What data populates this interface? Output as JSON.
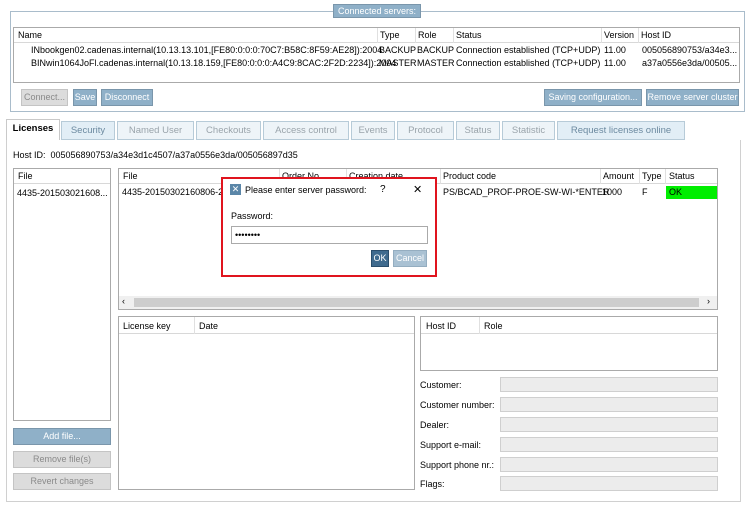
{
  "servers": {
    "title": "Connected servers:",
    "columns": [
      "Name",
      "Type",
      "Role",
      "Status",
      "Version",
      "Host ID"
    ],
    "rows": [
      [
        "INbookgen02.cadenas.internal(10.13.13.101,[FE80:0:0:0:70C7:B58C:8F59:AE28]):2004",
        "BACKUP",
        "BACKUP",
        "Connection established (TCP+UDP)",
        "11.00",
        "005056890753/a34e3..."
      ],
      [
        "BINwin1064JoFl.cadenas.internal(10.13.18.159,[FE80:0:0:0:A4C9:8CAC:2F2D:2234]):2004",
        "MASTER",
        "MASTER",
        "Connection established (TCP+UDP)",
        "11.00",
        "a37a0556e3da/00505..."
      ]
    ],
    "buttons": {
      "connect": "Connect...",
      "save": "Save",
      "disconnect": "Disconnect",
      "saving": "Saving configuration...",
      "remove": "Remove server cluster"
    }
  },
  "tabs": [
    "Licenses",
    "Security",
    "Named User",
    "Checkouts",
    "Access control",
    "Events",
    "Protocol",
    "Status",
    "Statistic",
    "Request licenses online"
  ],
  "host_id": "Host ID:  005056890753/a34e3d1c4507/a37a0556e3da/005056897d35",
  "files": {
    "header": "File",
    "items": [
      "4435-201503021608..."
    ]
  },
  "licenses": {
    "columns": [
      "File",
      "Order No.",
      "Creation date",
      "Product code",
      "Amount",
      "Type",
      "Status"
    ],
    "rows": [
      [
        "4435-20150302160806-20",
        "",
        "",
        "PS/BCAD_PROF-PROE-SW-WI-*ENTER",
        "1000",
        "F",
        "OK"
      ]
    ],
    "ok_color": "#00ee00"
  },
  "file_buttons": {
    "add": "Add file...",
    "remove": "Remove file(s)",
    "revert": "Revert changes"
  },
  "keys": {
    "columns": [
      "License key",
      "Date"
    ]
  },
  "hosts": {
    "columns": [
      "Host ID",
      "Role"
    ]
  },
  "fields": [
    "Customer:",
    "Customer number:",
    "Dealer:",
    "Support e-mail:",
    "Support phone nr.:",
    "Flags:"
  ],
  "dialog": {
    "title": "Please enter server password:",
    "help": "?",
    "close": "✕",
    "label": "Password:",
    "password": "abcdefgh",
    "ok": "OK",
    "cancel": "Cancel",
    "border_color": "#e0141e"
  }
}
